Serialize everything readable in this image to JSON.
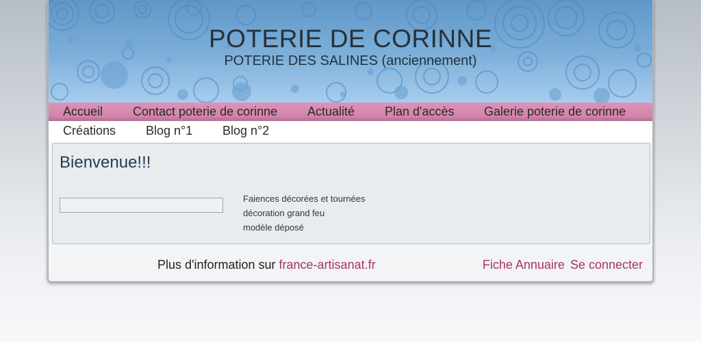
{
  "header": {
    "title": "POTERIE DE CORINNE",
    "subtitle": "POTERIE DES SALINES (anciennement)"
  },
  "nav": {
    "primary": [
      {
        "label": "Accueil"
      },
      {
        "label": "Contact poterie de corinne"
      },
      {
        "label": "Actualité"
      },
      {
        "label": "Plan d'accès"
      },
      {
        "label": "Galerie poterie de corinne"
      }
    ],
    "secondary": [
      {
        "label": "Créations"
      },
      {
        "label": "Blog n°1"
      },
      {
        "label": "Blog n°2"
      }
    ]
  },
  "content": {
    "title": "Bienvenue!!!",
    "description": [
      "Faiences décorées et tournées",
      "décoration grand feu",
      "modèle déposé"
    ]
  },
  "footer": {
    "info_prefix": "Plus d'information sur",
    "info_link": "france-artisanat.fr",
    "links": [
      {
        "label": "Fiche Annuaire"
      },
      {
        "label": "Se connecter"
      }
    ]
  },
  "colors": {
    "header_blue": "#7eb0da",
    "nav_pink": "#d385aa",
    "link_color": "#a8306f"
  }
}
